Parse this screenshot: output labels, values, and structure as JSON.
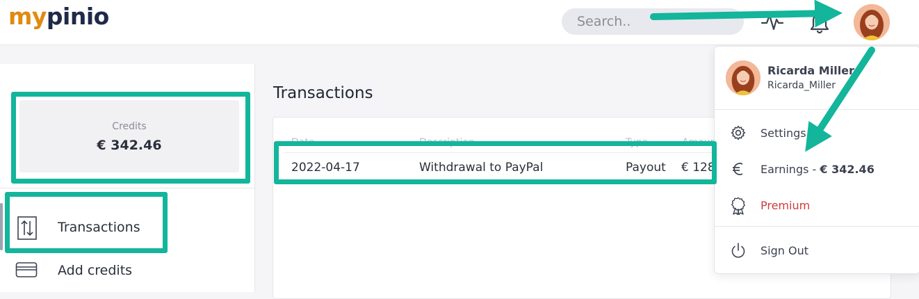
{
  "header": {
    "logo_part1": "my",
    "logo_part2": "pinio",
    "search_placeholder": "Search..",
    "avatar_alt": "User avatar"
  },
  "sidebar": {
    "credits_label": "Credits",
    "credits_value": "€ 342.46",
    "nav": [
      {
        "label": "Transactions",
        "icon": "transactions-icon",
        "active": true
      },
      {
        "label": "Add credits",
        "icon": "credit-card-icon",
        "active": false
      }
    ]
  },
  "main": {
    "title": "Transactions",
    "columns": [
      "Date",
      "Description",
      "Type",
      "Amour"
    ],
    "rows": [
      {
        "date": "2022-04-17",
        "description": "Withdrawal to PayPal",
        "type": "Payout",
        "amount": "€ 128"
      }
    ]
  },
  "dropdown": {
    "name": "Ricarda Miller",
    "username": "Ricarda_Miller",
    "items": [
      {
        "label": "Settings",
        "icon": "gear-icon"
      },
      {
        "label": "Earnings - ",
        "value": "€ 342.46",
        "icon": "euro-icon"
      },
      {
        "label": "Premium",
        "icon": "award-icon"
      },
      {
        "label": "Sign Out",
        "icon": "power-icon"
      }
    ]
  },
  "colors": {
    "highlight": "#13b59b",
    "logo_orange": "#e08a12",
    "logo_navy": "#1f2a4a",
    "premium_red": "#d23a3a"
  }
}
